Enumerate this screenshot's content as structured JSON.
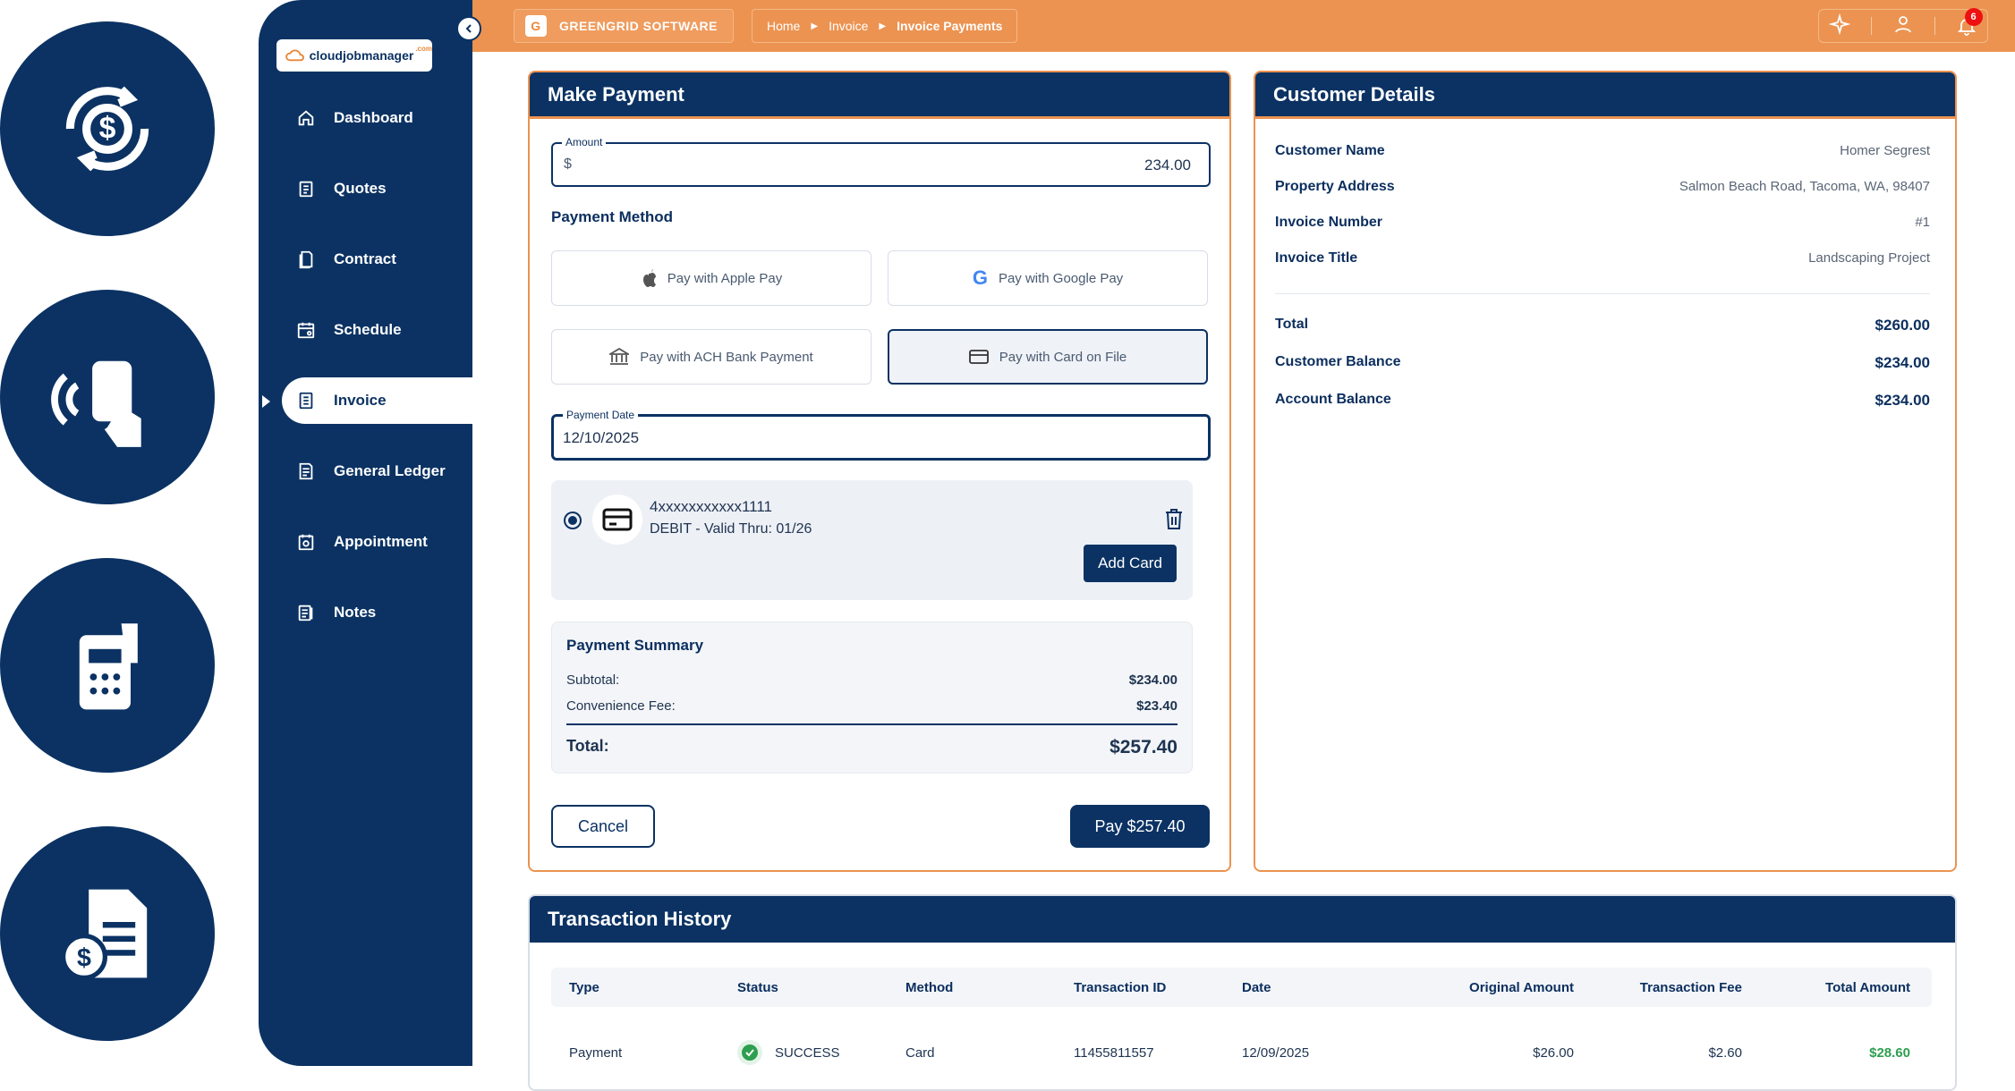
{
  "app": {
    "brand": "GREENGRID SOFTWARE",
    "brand_letter": "G",
    "logo_text": "cloudjobmanager",
    "logo_suffix": ".com",
    "notification_count": "6"
  },
  "breadcrumb": [
    "Home",
    "Invoice",
    "Invoice Payments"
  ],
  "sidebar": {
    "items": [
      {
        "label": "Dashboard",
        "icon": "home-icon"
      },
      {
        "label": "Quotes",
        "icon": "clipboard-icon"
      },
      {
        "label": "Contract",
        "icon": "document-icon"
      },
      {
        "label": "Schedule",
        "icon": "calendar-icon"
      },
      {
        "label": "Invoice",
        "icon": "invoice-icon",
        "active": true
      },
      {
        "label": "General Ledger",
        "icon": "ledger-icon"
      },
      {
        "label": "Appointment",
        "icon": "appointment-icon"
      },
      {
        "label": "Notes",
        "icon": "notes-icon"
      }
    ]
  },
  "make_payment": {
    "title": "Make Payment",
    "amount_label": "Amount",
    "currency": "$",
    "amount_value": "234.00",
    "payment_method_label": "Payment Method",
    "methods": [
      {
        "label": "Pay with Apple Pay",
        "icon": "apple-icon"
      },
      {
        "label": "Pay with Google Pay",
        "icon": "google-icon"
      },
      {
        "label": "Pay with ACH Bank Payment",
        "icon": "bank-icon"
      },
      {
        "label": "Pay with Card on File",
        "icon": "card-icon",
        "selected": true
      }
    ],
    "payment_date_label": "Payment Date",
    "payment_date": "12/10/2025",
    "saved_card": {
      "number": "4xxxxxxxxxxx1111",
      "detail": "DEBIT - Valid Thru: 01/26"
    },
    "add_card_label": "Add Card",
    "summary": {
      "title": "Payment Summary",
      "subtotal_label": "Subtotal:",
      "subtotal": "$234.00",
      "fee_label": "Convenience Fee:",
      "fee": "$23.40",
      "total_label": "Total:",
      "total": "$257.40"
    },
    "cancel_label": "Cancel",
    "pay_label": "Pay $257.40"
  },
  "customer_details": {
    "title": "Customer Details",
    "rows": [
      {
        "k": "Customer Name",
        "v": "Homer Segrest"
      },
      {
        "k": "Property Address",
        "v": "Salmon Beach Road, Tacoma, WA, 98407"
      },
      {
        "k": "Invoice Number",
        "v": "#1"
      },
      {
        "k": "Invoice Title",
        "v": "Landscaping Project"
      }
    ],
    "totals": [
      {
        "k": "Total",
        "v": "$260.00"
      },
      {
        "k": "Customer Balance",
        "v": "$234.00"
      },
      {
        "k": "Account Balance",
        "v": "$234.00"
      }
    ]
  },
  "transaction_history": {
    "title": "Transaction History",
    "columns": [
      "Type",
      "Status",
      "Method",
      "Transaction ID",
      "Date",
      "Original Amount",
      "Transaction Fee",
      "Total Amount"
    ],
    "rows": [
      {
        "type": "Payment",
        "status": "SUCCESS",
        "method": "Card",
        "id": "11455811557",
        "date": "12/09/2025",
        "original": "$26.00",
        "fee": "$2.60",
        "total": "$28.60"
      }
    ]
  },
  "colors": {
    "navy": "#0b3263",
    "orange": "#ec9351",
    "success": "#2e9e4f"
  }
}
